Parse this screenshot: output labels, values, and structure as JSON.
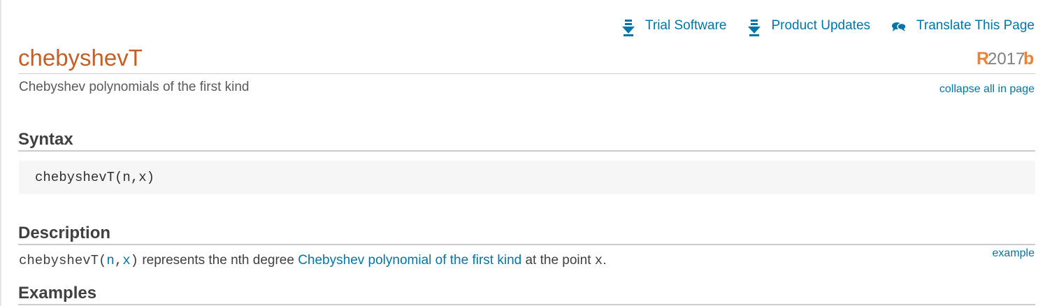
{
  "topbar": {
    "trial_label": "Trial Software",
    "updates_label": "Product Updates",
    "translate_label": "Translate This Page",
    "icons": [
      "download-icon",
      "download-icon",
      "speech-bubbles-icon"
    ]
  },
  "header": {
    "title": "chebyshevT",
    "release_prefix": "R",
    "release_year": "2017",
    "release_suffix": "b",
    "purpose": "Chebyshev polynomials of the first kind",
    "collapse_label": "collapse all in page"
  },
  "syntax": {
    "heading": "Syntax",
    "code": "chebyshevT(n,x)"
  },
  "description": {
    "heading": "Description",
    "func_start": "chebyshevT(",
    "arg_n": "n",
    "comma": ",",
    "arg_x": "x",
    "func_end": ")",
    "text_1": " represents the nth degree ",
    "link": "Chebyshev polynomial of the first kind",
    "text_2": " at the point ",
    "point": "x",
    "text_3": ".",
    "example_label": "example"
  },
  "examples": {
    "heading": "Examples"
  },
  "colors": {
    "link": "#0076a8",
    "title": "#c45f27",
    "release_accent": "#e8833a"
  }
}
